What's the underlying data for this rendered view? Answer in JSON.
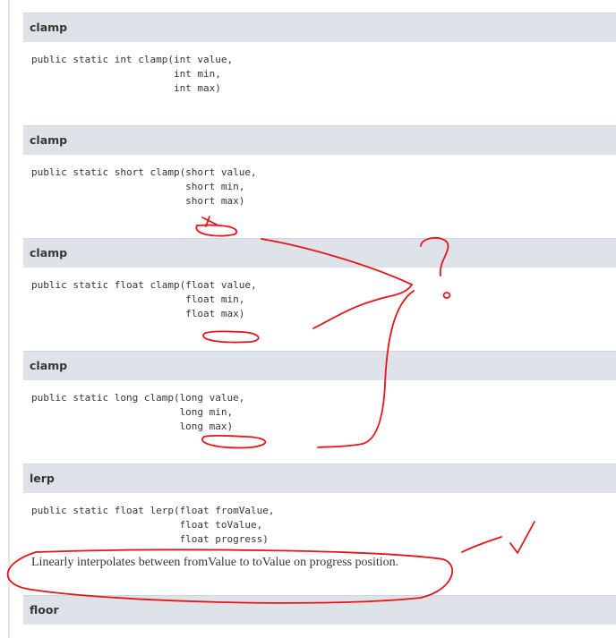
{
  "methods": [
    {
      "name": "clamp",
      "signature": [
        "public static int clamp(int value,",
        "                        int min,",
        "                        int max)"
      ]
    },
    {
      "name": "clamp",
      "signature": [
        "public static short clamp(short value,",
        "                          short min,",
        "                          short max)"
      ]
    },
    {
      "name": "clamp",
      "signature": [
        "public static float clamp(float value,",
        "                          float min,",
        "                          float max)"
      ]
    },
    {
      "name": "clamp",
      "signature": [
        "public static long clamp(long value,",
        "                         long min,",
        "                         long max)"
      ]
    },
    {
      "name": "lerp",
      "signature": [
        "public static float lerp(float fromValue,",
        "                         float toValue,",
        "                         float progress)"
      ],
      "description": "Linearly interpolates between fromValue to toValue on progress position."
    },
    {
      "name": "floor"
    }
  ],
  "annotations": {
    "color": "#e8131b"
  }
}
